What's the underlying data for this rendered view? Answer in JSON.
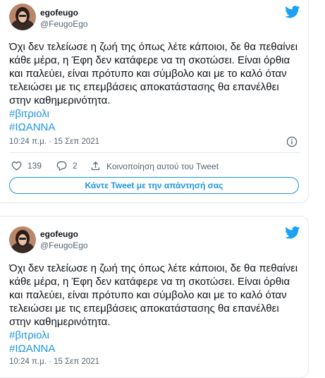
{
  "tweets": [
    {
      "author_name": "egofeugo",
      "author_handle": "@FeugoEgo",
      "text": "Όχι δεν τελείωσε η ζωή της όπως λέτε κάποιοι, δε θα πεθαίνει κάθε μέρα, η Έφη δεν κατάφερε να τη σκοτώσει. Είναι όρθια και παλεύει, είναι πρότυπο και σύμβολο και με το καλό όταν τελειώσει με τις επεμβάσεις αποκατάστασης θα επανέλθει στην καθημερινότητα.",
      "hashtags": [
        "#βιτριολι",
        "#ΙΩΑΝΝΑ"
      ],
      "timestamp": "10:24 π.μ. · 15 Σεπ 2021",
      "likes": "139",
      "replies": "2",
      "share_label": "Κοινοποίηση αυτού του Tweet",
      "reply_button_label": "Κάντε Tweet με την απάντησή σας"
    },
    {
      "author_name": "egofeugo",
      "author_handle": "@FeugoEgo",
      "text": "Όχι δεν τελείωσε η ζωή της όπως λέτε κάποιοι, δε θα πεθαίνει κάθε μέρα, η Έφη δεν κατάφερε να τη σκοτώσει. Είναι όρθια και παλεύει, είναι πρότυπο και σύμβολο και με το καλό όταν τελειώσει με τις επεμβάσεις αποκατάστασης θα επανέλθει στην καθημερινότητα.",
      "hashtags": [
        "#βιτριολι",
        "#ΙΩΑΝΝΑ"
      ],
      "timestamp": "10:24 π.μ. · 15 Σεπ 2021"
    }
  ],
  "colors": {
    "accent": "#1b95e0",
    "text": "#0f1419",
    "muted": "#536471",
    "border": "#e1e8ed"
  },
  "icons": [
    "twitter-bird-icon",
    "info-icon",
    "heart-icon",
    "reply-icon",
    "share-icon",
    "avatar"
  ]
}
